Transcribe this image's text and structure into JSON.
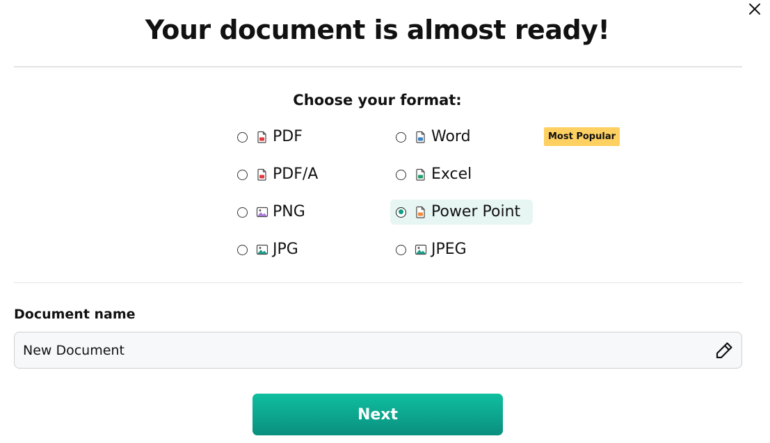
{
  "modal": {
    "title": "Your document is almost ready!",
    "close_icon": "close-icon"
  },
  "formats": {
    "heading": "Choose your format:",
    "badge": "Most Popular",
    "selected": "Power Point",
    "options": [
      {
        "label": "PDF",
        "icon": "pdf-file-icon",
        "color": "#e0393e"
      },
      {
        "label": "Word",
        "icon": "word-file-icon",
        "color": "#3b82c4"
      },
      {
        "label": "PDF/A",
        "icon": "pdfa-file-icon",
        "color": "#e0393e"
      },
      {
        "label": "Excel",
        "icon": "excel-file-icon",
        "color": "#1e9e6a"
      },
      {
        "label": "PNG",
        "icon": "png-image-icon",
        "color": "#a77ad8"
      },
      {
        "label": "Power Point",
        "icon": "powerpoint-file-icon",
        "color": "#f08a3c"
      },
      {
        "label": "JPG",
        "icon": "jpg-image-icon",
        "color": "#1e9e8a"
      },
      {
        "label": "JPEG",
        "icon": "jpeg-image-icon",
        "color": "#1e9e8a"
      }
    ]
  },
  "document": {
    "label": "Document name",
    "value": "New Document",
    "edit_icon": "pencil-icon"
  },
  "actions": {
    "next_label": "Next"
  },
  "colors": {
    "accent": "#0fa98e",
    "badge": "#fdd061",
    "selected_bg": "#e7f6f2"
  }
}
